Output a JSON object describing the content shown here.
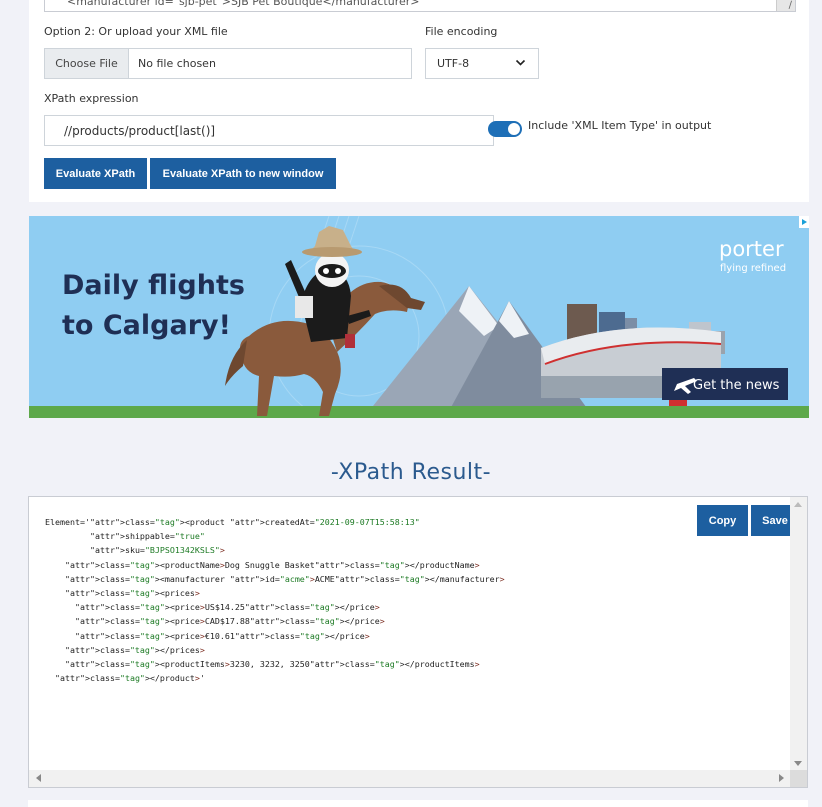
{
  "xml_input": {
    "visible_line": "<manufacturer id=\"sjb-pet\">SJB Pet Boutique</manufacturer>"
  },
  "upload": {
    "label": "Option 2: Or upload your XML file",
    "button_label": "Choose File",
    "status": "No file chosen"
  },
  "encoding": {
    "label": "File encoding",
    "selected": "UTF-8"
  },
  "xpath": {
    "label": "XPath expression",
    "value": "//products/product[last()]"
  },
  "toggle": {
    "label": "Include 'XML Item Type' in output",
    "checked": true
  },
  "buttons": {
    "evaluate": "Evaluate XPath",
    "evaluate_new_window": "Evaluate XPath to new window"
  },
  "ad": {
    "headline_line1": "Daily flights",
    "headline_line2": "to Calgary!",
    "brand": "porter",
    "tagline": "flying refined",
    "cta": "Get the news"
  },
  "result": {
    "title": "-XPath Result-",
    "copy_label": "Copy",
    "save_label": "Save",
    "lines": [
      "Element='<product createdAt=\"2021-09-07T15:58:13\"",
      "         shippable=\"true\"",
      "         sku=\"BJPSO1342KSLS\">",
      "    <productName>Dog Snuggle Basket</productName>",
      "    <manufacturer id=\"acme\">ACME</manufacturer>",
      "    <prices>",
      "      <price>US$14.25</price>",
      "      <price>CAD$17.88</price>",
      "      <price>€10.61</price>",
      "    </prices>",
      "    <productItems>3230, 3232, 3250</productItems>",
      "  </product>'"
    ]
  },
  "colors": {
    "primary_button": "#1d5fa0",
    "toggle_on": "#1e6fb7",
    "title_blue": "#2b5a8e",
    "ad_sky": "#8fcdf2",
    "ad_navy": "#1f2f55"
  }
}
